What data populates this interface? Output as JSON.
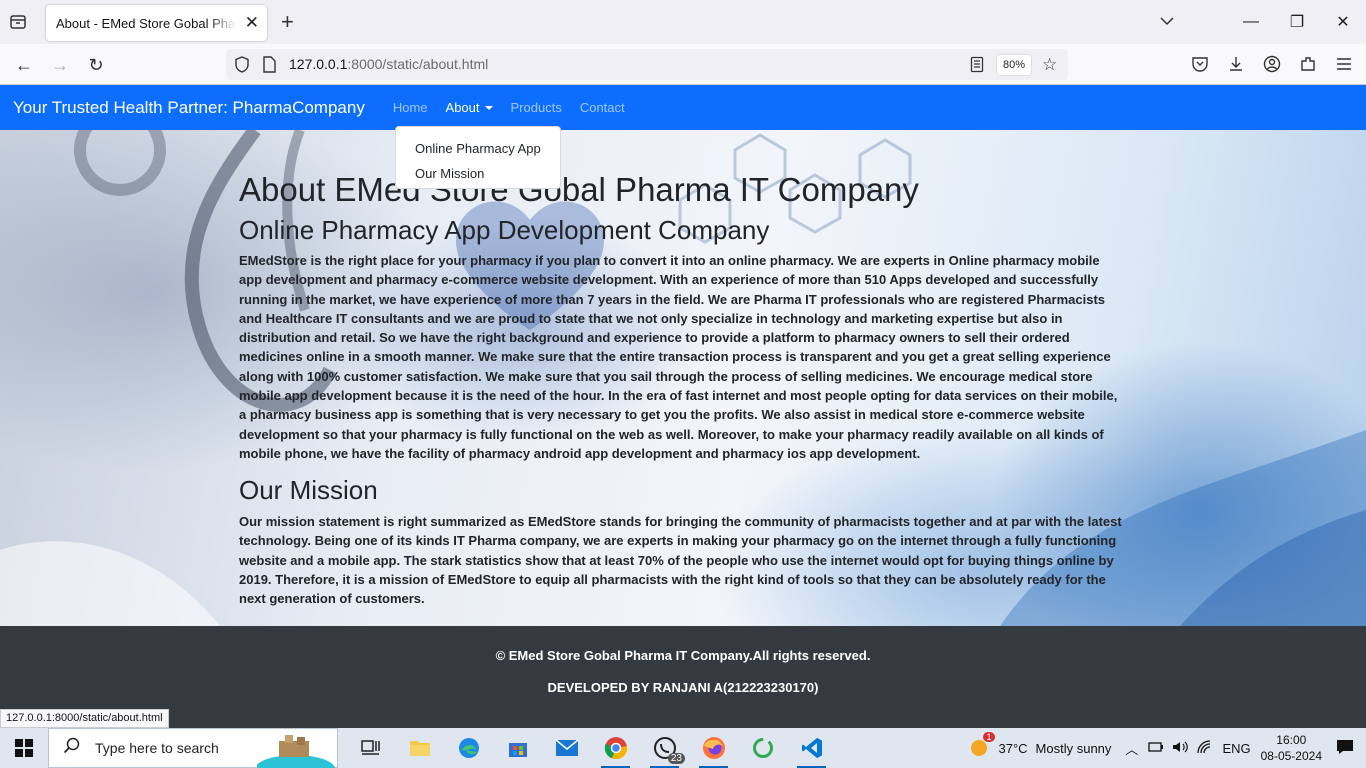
{
  "browser": {
    "tab_title": "About - EMed Store Gobal Pharma IT Company",
    "url_host": "127.0.0.1",
    "url_rest": ":8000/static/about.html",
    "zoom": "80%",
    "status_url": "127.0.0.1:8000/static/about.html"
  },
  "site": {
    "brand": "Your Trusted Health Partner: PharmaCompany",
    "nav": {
      "home": "Home",
      "about": "About",
      "products": "Products",
      "contact": "Contact"
    },
    "dropdown": [
      "Online Pharmacy App",
      "Our Mission"
    ],
    "title": "About EMed Store Gobal Pharma IT Company",
    "section1": {
      "heading": "Online Pharmacy App Development Company",
      "body": "EMedStore is the right place for your pharmacy if you plan to convert it into an online pharmacy. We are experts in Online pharmacy mobile app development and pharmacy e-commerce website development. With an experience of more than 510 Apps developed and successfully running in the market, we have experience of more than 7 years in the field. We are Pharma IT professionals who are registered Pharmacists and Healthcare IT consultants and we are proud to state that we not only specialize in technology and marketing expertise but also in distribution and retail. So we have the right background and experience to provide a platform to pharmacy owners to sell their ordered medicines online in a smooth manner. We make sure that the entire transaction process is transparent and you get a great selling experience along with 100% customer satisfaction. We make sure that you sail through the process of selling medicines. We encourage medical store mobile app development because it is the need of the hour. In the era of fast internet and most people opting for data services on their mobile, a pharmacy business app is something that is very necessary to get you the profits. We also assist in medical store e-commerce website development so that your pharmacy is fully functional on the web as well. Moreover, to make your pharmacy readily available on all kinds of mobile phone, we have the facility of pharmacy android app development and pharmacy ios app development."
    },
    "section2": {
      "heading": "Our Mission",
      "body": "Our mission statement is right summarized as EMedStore stands for bringing the community of pharmacists together and at par with the latest technology. Being one of its kinds IT Pharma company, we are experts in making your pharmacy go on the internet through a fully functioning website and a mobile app. The stark statistics show that at least 70% of the people who use the internet would opt for buying things online by 2019. Therefore, it is a mission of EMedStore to equip all pharmacists with the right kind of tools so that they can be absolutely ready for the next generation of customers."
    },
    "footer": {
      "copyright": "© EMed Store Gobal Pharma IT Company.All rights reserved.",
      "developer": "DEVELOPED BY RANJANI A(212223230170)"
    }
  },
  "taskbar": {
    "search_placeholder": "Type here to search",
    "whatsapp_badge": "23",
    "weather_temp": "37°C",
    "weather_text": "Mostly sunny",
    "weather_badge": "1",
    "lang": "ENG",
    "time": "16:00",
    "date": "08-05-2024"
  },
  "colors": {
    "nav_bg": "#0d6efd",
    "footer_bg": "#343a40"
  }
}
